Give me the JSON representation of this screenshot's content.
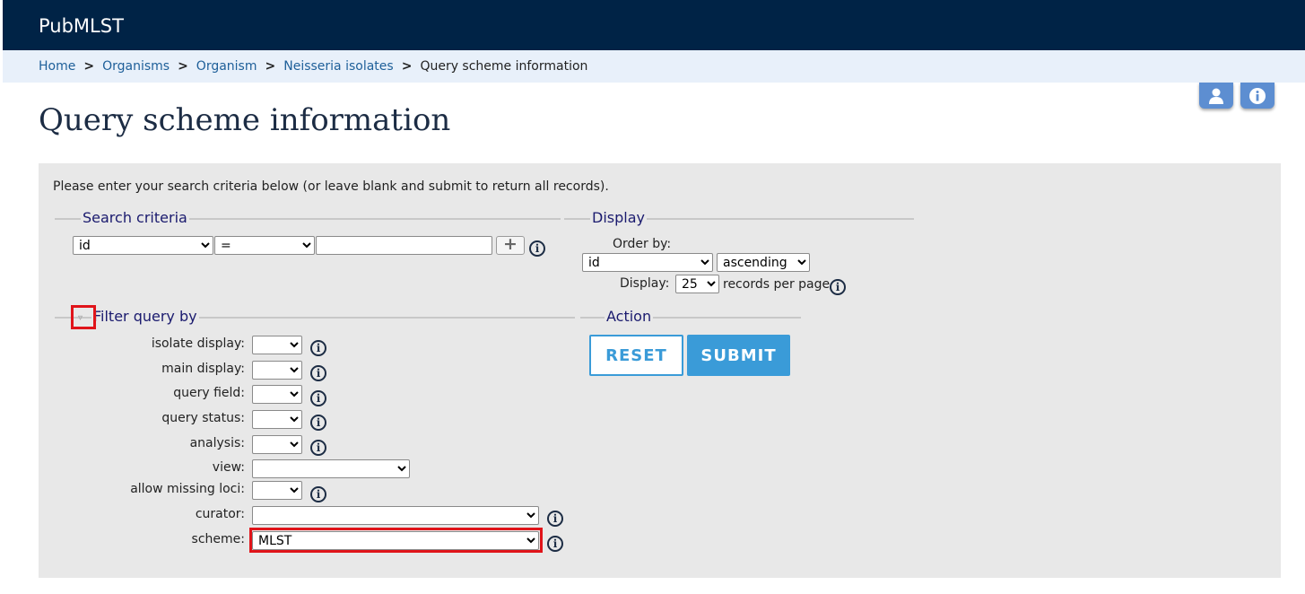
{
  "header": {
    "title": "PubMLST"
  },
  "breadcrumb": {
    "items": [
      "Home",
      "Organisms",
      "Organism",
      "Neisseria isolates"
    ],
    "current": "Query scheme information",
    "separator": ">"
  },
  "page_title": "Query scheme information",
  "intro": "Please enter your search criteria below (or leave blank and submit to return all records).",
  "search": {
    "legend": "Search criteria",
    "field_value": "id",
    "operator_value": "=",
    "value_text": "",
    "add_icon": "+"
  },
  "display": {
    "legend": "Display",
    "order_by_label": "Order by:",
    "order_field": "id",
    "order_direction": "ascending",
    "display_label": "Display:",
    "per_page": "25",
    "per_page_suffix": "records per page"
  },
  "filters": {
    "legend": "Filter query by",
    "items": [
      {
        "label": "isolate display:",
        "value": ""
      },
      {
        "label": "main display:",
        "value": ""
      },
      {
        "label": "query field:",
        "value": ""
      },
      {
        "label": "query status:",
        "value": ""
      },
      {
        "label": "analysis:",
        "value": ""
      },
      {
        "label": "view:",
        "value": ""
      },
      {
        "label": "allow missing loci:",
        "value": ""
      },
      {
        "label": "curator:",
        "value": ""
      },
      {
        "label": "scheme:",
        "value": "MLST"
      }
    ]
  },
  "action": {
    "legend": "Action",
    "reset_label": "RESET",
    "submit_label": "SUBMIT"
  },
  "icons": {
    "info": "i",
    "user": "user-icon",
    "about": "info-icon"
  },
  "colors": {
    "header": "#002346",
    "accent": "#3a9bd8",
    "highlight": "#e0141a"
  }
}
